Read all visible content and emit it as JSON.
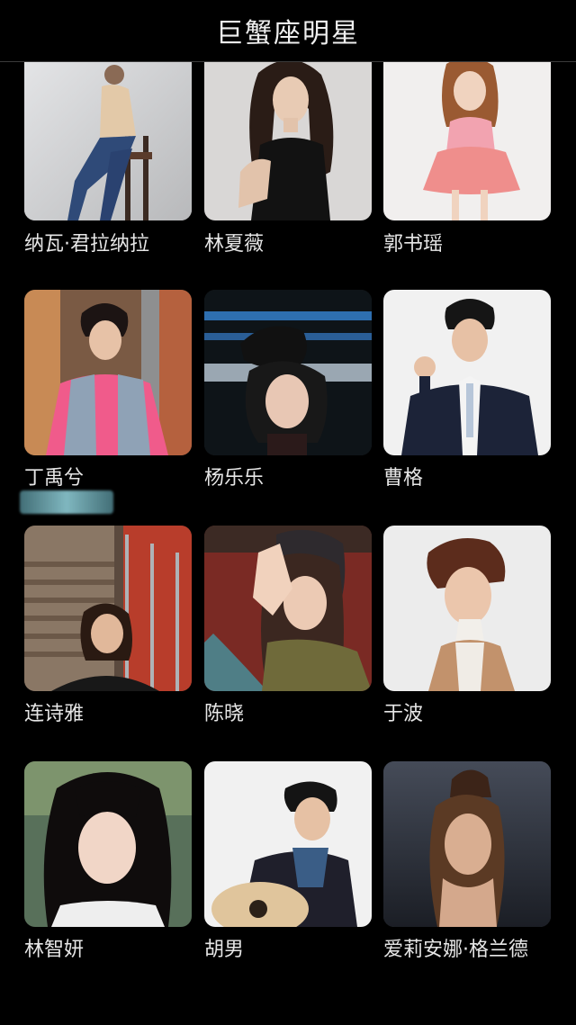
{
  "header": {
    "title": "巨蟹座明星"
  },
  "stars": [
    {
      "name": "纳瓦·君拉纳拉"
    },
    {
      "name": "林夏薇"
    },
    {
      "name": "郭书瑶"
    },
    {
      "name": "丁禹兮"
    },
    {
      "name": "杨乐乐"
    },
    {
      "name": "曹格"
    },
    {
      "name": "连诗雅"
    },
    {
      "name": "陈晓"
    },
    {
      "name": "于波"
    },
    {
      "name": "林智妍"
    },
    {
      "name": "胡男"
    },
    {
      "name": "爱莉安娜·格兰德"
    }
  ]
}
